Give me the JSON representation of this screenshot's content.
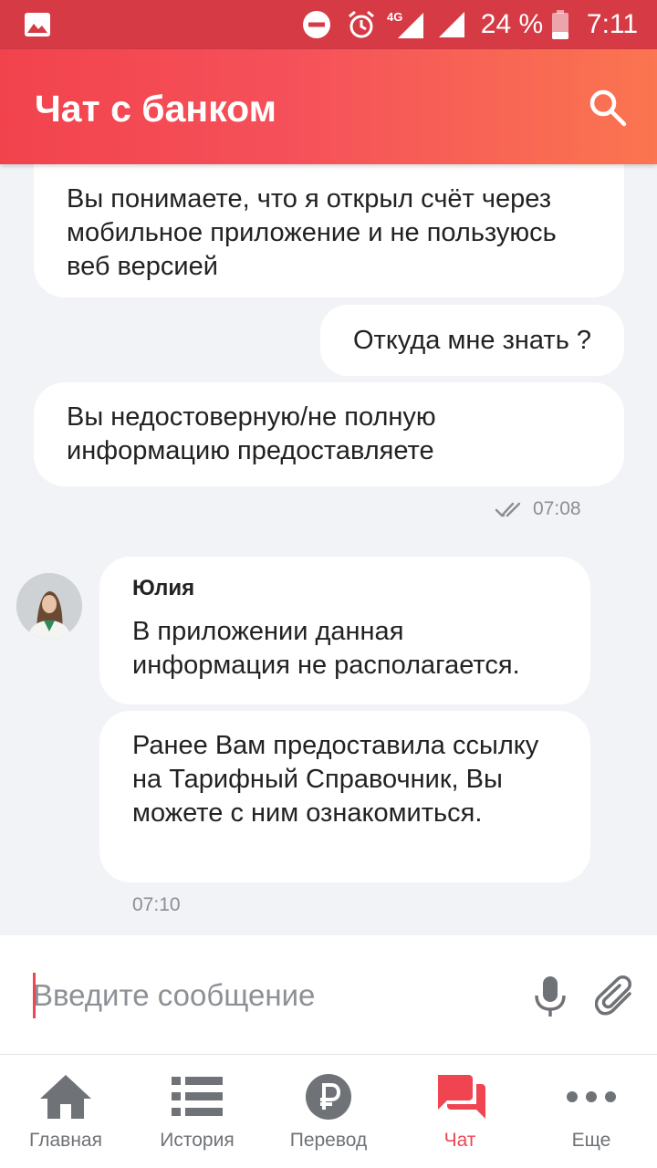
{
  "status_bar": {
    "network": "4G",
    "battery_percent": "24 %",
    "time": "7:11"
  },
  "header": {
    "title": "Чат с банком"
  },
  "messages": {
    "m1": "Вы понимаете, что я открыл счёт через мобильное приложение и не пользуюсь веб версией",
    "m2": "Откуда мне знать ?",
    "m3": "Вы недостоверную/не полную информацию предоставляете",
    "m3_time": "07:08",
    "agent_name": "Юлия",
    "m4": "В приложении данная информация не располагается.",
    "m5": "Ранее Вам предоставила ссылку на Тарифный Справочник, Вы можете с ним ознакомиться.",
    "m5_time": "07:10"
  },
  "input": {
    "placeholder": "Введите сообщение"
  },
  "bottom_nav": {
    "items": [
      {
        "label": "Главная",
        "icon": "home-icon"
      },
      {
        "label": "История",
        "icon": "list-icon"
      },
      {
        "label": "Перевод",
        "icon": "ruble-icon"
      },
      {
        "label": "Чат",
        "icon": "chat-icon",
        "active": true
      },
      {
        "label": "Еще",
        "icon": "more-icon"
      }
    ]
  },
  "colors": {
    "accent": "#f04550",
    "status_bar": "#d63a45",
    "header_gradient_start": "#f2434d",
    "header_gradient_end": "#fb7550",
    "chat_background": "#f2f3f6"
  }
}
